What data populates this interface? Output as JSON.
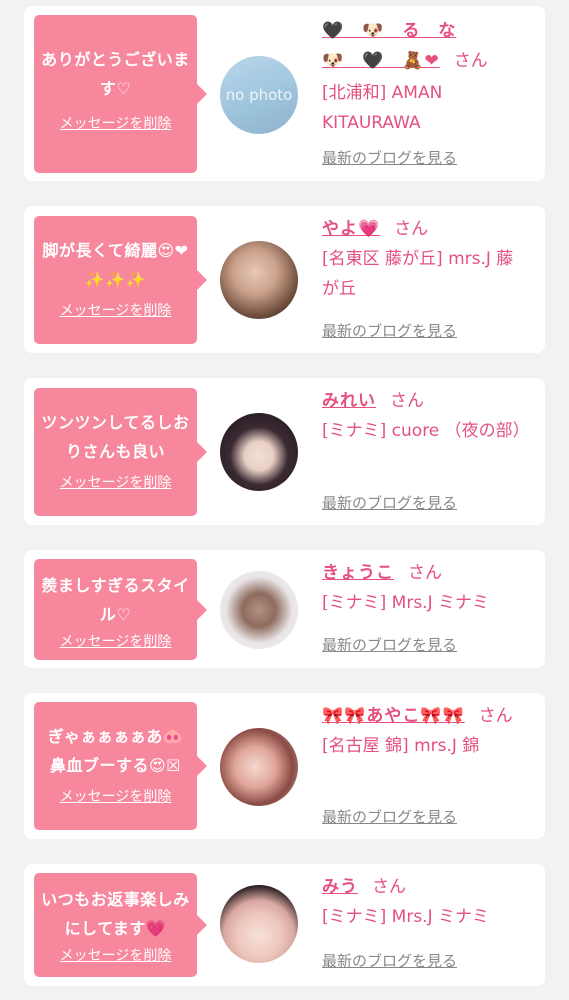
{
  "delete_label": "メッセージを削除",
  "blog_label": "最新のブログを見る",
  "san_label": "さん",
  "colors": {
    "accent": "#f7879d",
    "name_text": "#e5507d",
    "link_gray": "#888888",
    "background": "#f2f2f2"
  },
  "messages": [
    {
      "message": "ありがとうございます♡",
      "name": "🖤　🐶　る　な\n🐶　🖤　🧸❤",
      "shop": "[北浦和] AMAN KITAURAWA",
      "avatar": "no photo"
    },
    {
      "message": "脚が長くて綺麗😍❤✨✨✨",
      "name": "やよ💗",
      "shop": "[名東区 藤が丘] mrs.J 藤が丘",
      "avatar": "photo"
    },
    {
      "message": "ツンツンしてるしおりさんも良い",
      "name": "みれい",
      "shop": "[ミナミ] cuore （夜の部）",
      "avatar": "anime-girl"
    },
    {
      "message": "羨ましすぎるスタイル♡",
      "name": "きょうこ",
      "shop": "[ミナミ] Mrs.J ミナミ",
      "avatar": "hair-photo"
    },
    {
      "message": "ぎゃぁぁぁぁあ🐽鼻血ブーする😍☒",
      "name": "🎀🎀あやこ🎀🎀",
      "shop": "[名古屋 錦] mrs.J 錦",
      "avatar": "photo"
    },
    {
      "message": "いつもお返事楽しみにしてます💗",
      "name": "みう",
      "shop": "[ミナミ] Mrs.J ミナミ",
      "avatar": "photo"
    }
  ]
}
